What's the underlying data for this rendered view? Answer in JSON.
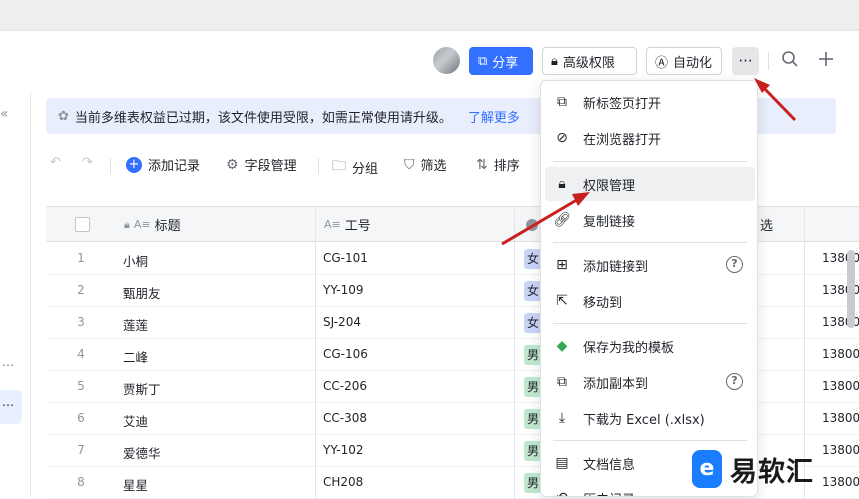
{
  "header": {
    "share_label": "分享",
    "permissions_label": "高级权限",
    "automation_label": "自动化",
    "more_label": "···",
    "search_icon": "search-icon",
    "add_icon": "plus-icon"
  },
  "sidebar": {
    "collapse": "«",
    "more1": "⋯",
    "more2": "⋯"
  },
  "banner": {
    "text": "当前多维表权益已过期，该文件使用受限，如需正常使用请升级。",
    "link": "了解更多"
  },
  "toolbar": {
    "add_record": "添加记录",
    "field_manage": "字段管理",
    "group": "分组",
    "filter": "筛选",
    "sort": "排序"
  },
  "grid": {
    "columns": [
      "标题",
      "工号",
      "",
      "筛选"
    ],
    "col4_partial": "选",
    "rows": [
      {
        "num": "1",
        "title": "小桐",
        "code": "CG-101",
        "tag": "女",
        "phone": "13800"
      },
      {
        "num": "2",
        "title": "甄朋友",
        "code": "YY-109",
        "tag": "女",
        "phone": "13800"
      },
      {
        "num": "3",
        "title": "莲莲",
        "code": "SJ-204",
        "tag": "女",
        "phone": "13800"
      },
      {
        "num": "4",
        "title": "二峰",
        "code": "CG-106",
        "tag": "男",
        "phone": "13800"
      },
      {
        "num": "5",
        "title": "贾斯丁",
        "code": "CC-206",
        "tag": "男",
        "phone": "13800"
      },
      {
        "num": "6",
        "title": "艾迪",
        "code": "CC-308",
        "tag": "男",
        "phone": "13800"
      },
      {
        "num": "7",
        "title": "爱德华",
        "code": "YY-102",
        "tag": "男",
        "phone": "13800"
      },
      {
        "num": "8",
        "title": "星星",
        "code": "CH208",
        "tag": "男",
        "phone": "13800"
      }
    ],
    "tag_colors": {
      "女": "#c9d4f7",
      "男": "#bfe8cf"
    }
  },
  "menu": {
    "items": [
      {
        "label": "新标签页打开"
      },
      {
        "label": "在浏览器打开"
      },
      {
        "label": "权限管理"
      },
      {
        "label": "复制链接"
      },
      {
        "label": "添加链接到"
      },
      {
        "label": "移动到"
      },
      {
        "label": "保存为我的模板"
      },
      {
        "label": "添加副本到"
      },
      {
        "label": "下载为 Excel (.xlsx)"
      },
      {
        "label": "文档信息"
      },
      {
        "label": "历史记录"
      }
    ],
    "help": "?"
  },
  "watermark_logo": {
    "mark": "e",
    "text": "易软汇"
  },
  "colors": {
    "accent": "#3370ff",
    "arrow": "#c8201f"
  }
}
